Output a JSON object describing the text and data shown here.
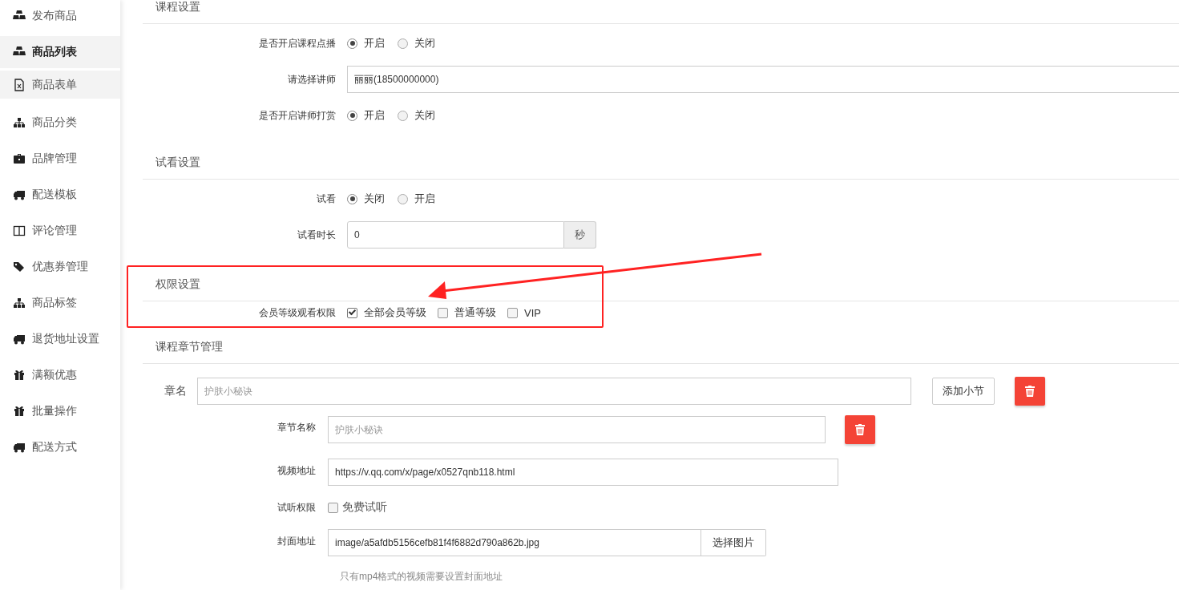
{
  "sidebar": {
    "items": [
      {
        "label": "发布商品",
        "selected": false,
        "hovered": false
      },
      {
        "label": "商品列表",
        "selected": true,
        "hovered": false
      },
      {
        "label": "商品表单",
        "selected": false,
        "hovered": true
      },
      {
        "label": "商品分类",
        "selected": false,
        "hovered": false
      },
      {
        "label": "品牌管理",
        "selected": false,
        "hovered": false
      },
      {
        "label": "配送模板",
        "selected": false,
        "hovered": false
      },
      {
        "label": "评论管理",
        "selected": false,
        "hovered": false
      },
      {
        "label": "优惠券管理",
        "selected": false,
        "hovered": false
      },
      {
        "label": "商品标签",
        "selected": false,
        "hovered": false
      },
      {
        "label": "退货地址设置",
        "selected": false,
        "hovered": false
      },
      {
        "label": "满额优惠",
        "selected": false,
        "hovered": false
      },
      {
        "label": "批量操作",
        "selected": false,
        "hovered": false
      },
      {
        "label": "配送方式",
        "selected": false,
        "hovered": false
      }
    ]
  },
  "sections": [
    {
      "title": "课程设置",
      "fields": [
        {
          "kind": "radio",
          "label": "是否开启课程点播",
          "options": [
            {
              "label": "开启",
              "selected": true
            },
            {
              "label": "关闭",
              "selected": false
            }
          ]
        },
        {
          "kind": "text",
          "label": "请选择讲师",
          "value": "丽丽(18500000000)"
        },
        {
          "kind": "radio",
          "label": "是否开启讲师打赏",
          "options": [
            {
              "label": "开启",
              "selected": true
            },
            {
              "label": "关闭",
              "selected": false
            }
          ]
        }
      ]
    },
    {
      "title": "试看设置",
      "fields": [
        {
          "kind": "radio",
          "label": "试看",
          "options": [
            {
              "label": "关闭",
              "selected": true
            },
            {
              "label": "开启",
              "selected": false
            }
          ]
        },
        {
          "kind": "addon",
          "label": "试看时长",
          "value": "0",
          "addon": "秒"
        }
      ]
    },
    {
      "title": "权限设置",
      "highlighted": true,
      "fields": [
        {
          "kind": "checkbox",
          "label": "会员等级观看权限",
          "options": [
            {
              "label": "全部会员等级",
              "checked": true
            },
            {
              "label": "普通等级",
              "checked": false
            },
            {
              "label": "VIP",
              "checked": false
            }
          ]
        }
      ]
    }
  ],
  "chapter_section": {
    "title": "课程章节管理",
    "chapter": {
      "label": "章名",
      "placeholder": "护肤小秘诀",
      "add_button": "添加小节"
    },
    "lesson_fields": [
      {
        "kind": "text",
        "label": "章节名称",
        "placeholder": "护肤小秘诀",
        "deletable": true
      },
      {
        "kind": "text",
        "label": "视频地址",
        "value": "https://v.qq.com/x/page/x0527qnb118.html",
        "deletable": false
      },
      {
        "kind": "checkbox",
        "label": "试听权限",
        "option": "免费试听",
        "checked": false
      },
      {
        "kind": "file",
        "label": "封面地址",
        "value": "image/a5afdb5156cefb81f4f6882d790a862b.jpg",
        "button": "选择图片"
      },
      {
        "kind": "hint",
        "text": "只有mp4格式的视频需要设置封面地址"
      }
    ]
  }
}
